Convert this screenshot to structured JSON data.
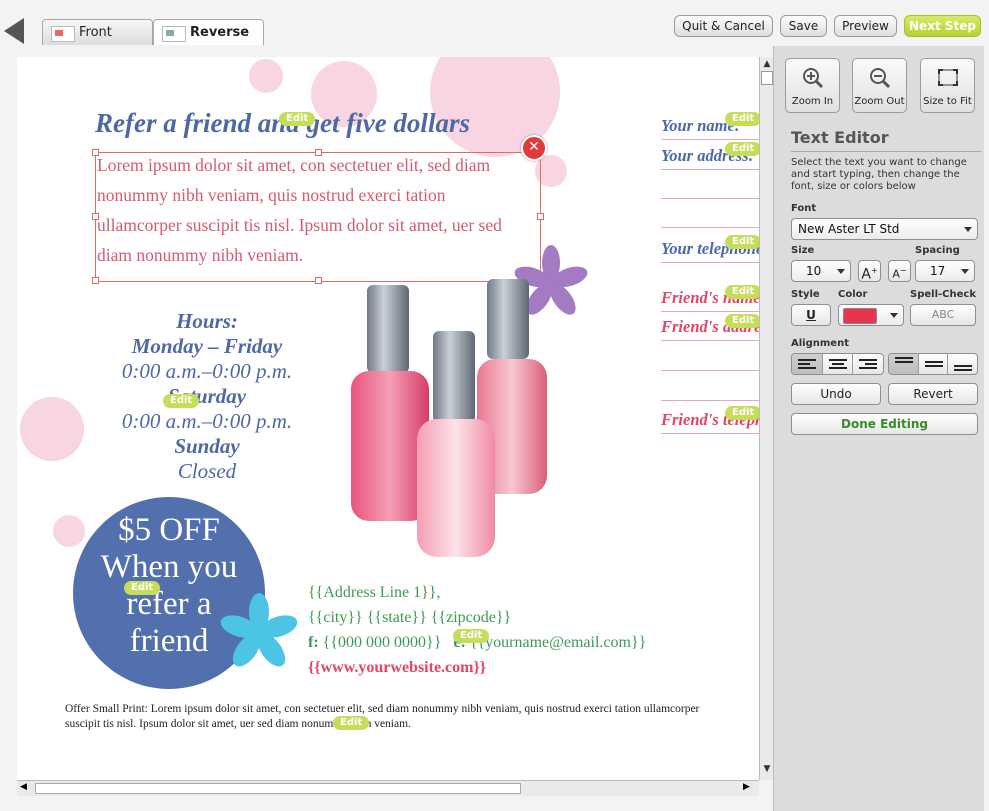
{
  "toolbar": {
    "tabs": [
      {
        "label": "Front",
        "active": false
      },
      {
        "label": "Reverse",
        "active": true
      }
    ],
    "quit_label": "Quit & Cancel",
    "save_label": "Save",
    "preview_label": "Preview",
    "next_label": "Next Step"
  },
  "document": {
    "headline": "Refer a friend and get five dollars",
    "body": "Lorem ipsum dolor sit amet, con sectetuer elit, sed diam nonummy nibh veniam, quis nostrud exerci tation ullamcorper suscipit tis nisl. Ipsum dolor sit amet, uer sed diam nonummy nibh veniam.",
    "hours": {
      "title": "Hours:",
      "days1": "Monday – Friday",
      "time1": "0:00 a.m.–0:00 p.m.",
      "days2": "Saturday",
      "time2": "0:00 a.m.–0:00 p.m.",
      "days3": "Sunday",
      "time3": "Closed"
    },
    "badge": {
      "line1": "$5 OFF",
      "line2": "When you",
      "line3": "refer a",
      "line4": "friend"
    },
    "address": {
      "line1": "{{Address Line 1}},",
      "line2": "{{city}} {{state}} {{zipcode}}",
      "phone_label": "f:",
      "phone": "{{000 000 0000}}",
      "email_label": "e:",
      "email": "{{yourname@email.com}}",
      "website": "{{www.yourwebsite.com}}"
    },
    "fine_print": "Offer Small Print: Lorem ipsum dolor sit amet, con sectetuer elit, sed diam nonummy nibh veniam, quis nostrud exerci tation ullamcorper suscipit tis nisl. Ipsum dolor sit amet, uer sed diam nonummy nibh veniam.",
    "form_labels": [
      {
        "text": "Your name:",
        "color": "#4e68a6"
      },
      {
        "text": "Your address:",
        "color": "#4e68a6"
      },
      {
        "text": "Your telephone:",
        "color": "#4e68a6"
      },
      {
        "text": "Friend's name:",
        "color": "#e24665"
      },
      {
        "text": "Friend's address:",
        "color": "#e24665"
      },
      {
        "text": "Friend's telephone:",
        "color": "#e24665"
      }
    ],
    "edit_tag": "Edit"
  },
  "panel": {
    "zoom_in": "Zoom In",
    "zoom_out": "Zoom Out",
    "size_to_fit": "Size to Fit",
    "title": "Text Editor",
    "description": "Select the text you want to change and start typing, then change the font, size or colors below",
    "font_label": "Font",
    "font_value": "New Aster LT Std",
    "size_label": "Size",
    "size_value": "10",
    "spacing_label": "Spacing",
    "spacing_value": "17",
    "style_label": "Style",
    "underline": "U",
    "color_label": "Color",
    "color_value": "#e9344f",
    "spell_label": "Spell-Check",
    "spell_button": "ABC",
    "alignment_label": "Alignment",
    "undo": "Undo",
    "revert": "Revert",
    "done": "Done Editing"
  }
}
